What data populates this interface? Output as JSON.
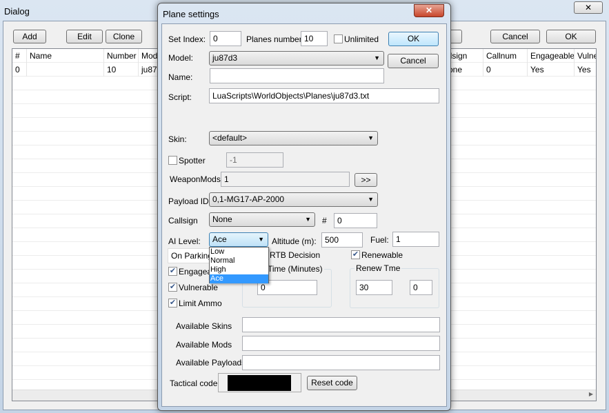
{
  "bg_dialog": {
    "title": "Dialog",
    "buttons": {
      "add": "Add",
      "edit": "Edit",
      "clone": "Clone",
      "cancel": "Cancel",
      "ok": "OK"
    },
    "columns_left": [
      "#",
      "Name",
      "Number",
      "Mode"
    ],
    "columns_right": [
      "llsign",
      "Callnum",
      "Engageable",
      "Vulne"
    ],
    "row_left": [
      "0",
      "",
      "10",
      "ju87"
    ],
    "row_right": [
      "one",
      "0",
      "Yes",
      "Yes"
    ]
  },
  "plane": {
    "title": "Plane settings",
    "set_index_label": "Set Index:",
    "set_index": "0",
    "planes_number_label": "Planes number:",
    "planes_number": "10",
    "unlimited_label": "Unlimited",
    "unlimited_checked": false,
    "ok": "OK",
    "cancel": "Cancel",
    "model_label": "Model:",
    "model": "ju87d3",
    "name_label": "Name:",
    "name": "",
    "script_label": "Script:",
    "script": "LuaScripts\\WorldObjects\\Planes\\ju87d3.txt",
    "skin_label": "Skin:",
    "skin": "<default>",
    "spotter_label": "Spotter",
    "spotter_checked": false,
    "spotter_value": "-1",
    "weaponmods_label": "WeaponMods:",
    "weaponmods": "1",
    "more_button": ">>",
    "payload_label": "Payload ID:",
    "payload": "0,1-MG17-AP-2000",
    "callsign_label": "Callsign",
    "callsign": "None",
    "hash_label": "#",
    "callnum": "0",
    "ai_label": "AI Level:",
    "ai_level": "Ace",
    "ai_options": [
      "Low",
      "Normal",
      "High",
      "Ace"
    ],
    "altitude_label": "Altitude (m):",
    "altitude": "500",
    "fuel_label": "Fuel:",
    "fuel": "1",
    "start": "On Parking",
    "rtb_label": "RTB Decision",
    "renewable_label": "Renewable",
    "renewable_checked": true,
    "engageable_label": "Engageal",
    "vulnerable_label": "Vulnerable",
    "limit_ammo_label": "Limit Ammo",
    "time_group_label": "Time (Minutes)",
    "time_value": "0",
    "renew_group_label": "Renew Tme",
    "renew_a": "30",
    "renew_b": "0",
    "avail_skins_label": "Available Skins",
    "avail_mods_label": "Available Mods",
    "avail_payloads_label": "Available Payloads",
    "tactical_label": "Tactical code",
    "tactical_color": "#000000",
    "reset_code": "Reset code"
  }
}
